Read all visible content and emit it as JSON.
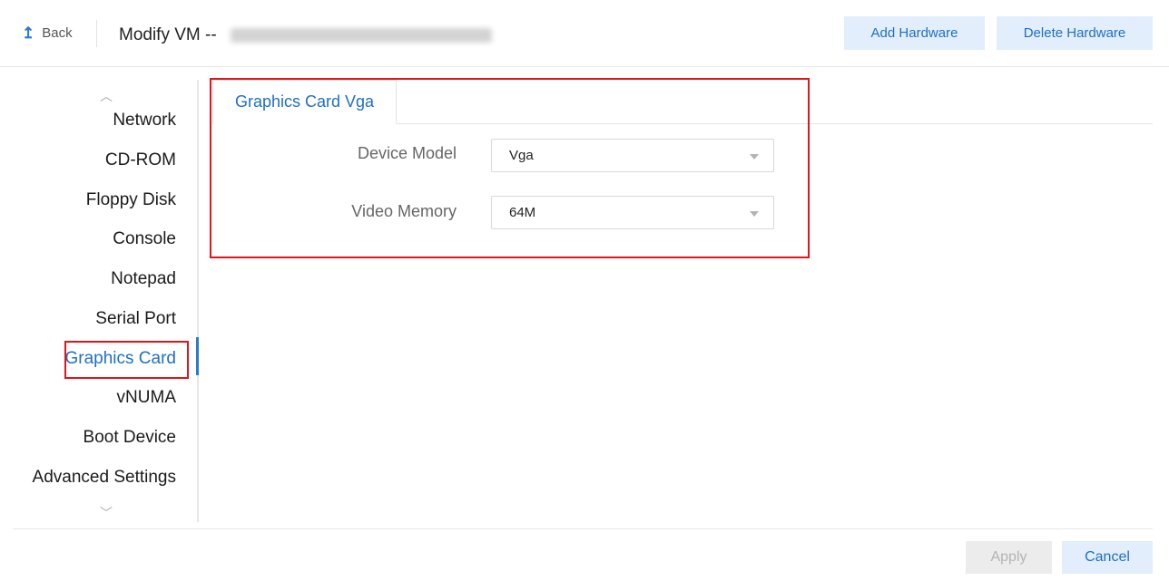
{
  "header": {
    "back_label": "Back",
    "title": "Modify VM --",
    "add_hardware_label": "Add Hardware",
    "delete_hardware_label": "Delete Hardware"
  },
  "sidebar": {
    "items": [
      {
        "label": "Network"
      },
      {
        "label": "CD-ROM"
      },
      {
        "label": "Floppy Disk"
      },
      {
        "label": "Console"
      },
      {
        "label": "Notepad"
      },
      {
        "label": "Serial Port"
      },
      {
        "label": "Graphics Card"
      },
      {
        "label": "vNUMA"
      },
      {
        "label": "Boot Device"
      },
      {
        "label": "Advanced Settings"
      }
    ],
    "active_item": "Graphics Card"
  },
  "content": {
    "tab_label": "Graphics Card Vga",
    "fields": {
      "device_model": {
        "label": "Device Model",
        "value": "Vga"
      },
      "video_memory": {
        "label": "Video Memory",
        "value": "64M"
      }
    }
  },
  "footer": {
    "apply_label": "Apply",
    "cancel_label": "Cancel"
  },
  "colors": {
    "accent": "#1f6fc4",
    "button_bg": "#e2eefb",
    "highlight_border": "#e0141a",
    "disabled_bg": "#ececec"
  },
  "icons": {
    "back": "back-arrow-icon",
    "scroll_up": "chevron-up-icon",
    "scroll_down": "chevron-down-icon",
    "dropdown": "caret-down-icon"
  }
}
